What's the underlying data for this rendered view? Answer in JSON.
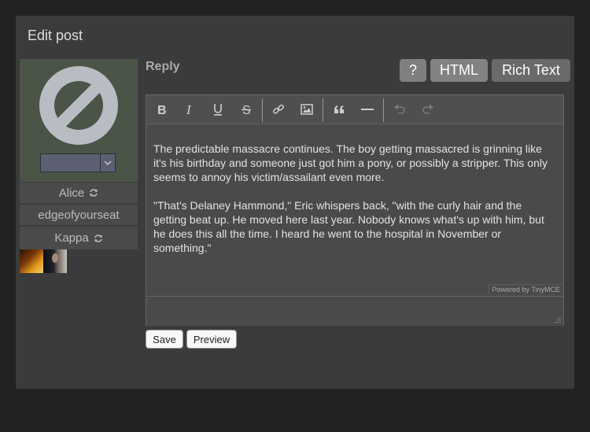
{
  "panel": {
    "title": "Edit post"
  },
  "sidebar": {
    "avatar_icon": "no-avatar-icon",
    "icon_select_value": "",
    "accounts": [
      {
        "name": "Alice",
        "has_refresh": true
      },
      {
        "name": "edgeofyourseat",
        "has_refresh": false
      },
      {
        "name": "Kappa",
        "has_refresh": true
      }
    ],
    "thumbnails": [
      "landscape-thumbnail",
      "person-thumbnail"
    ]
  },
  "main": {
    "reply_label": "Reply",
    "mode_buttons": {
      "help": "?",
      "html": "HTML",
      "rich_text": "Rich Text"
    }
  },
  "editor": {
    "toolbar": [
      "bold-icon",
      "italic-icon",
      "underline-icon",
      "strikethrough-icon",
      "link-icon",
      "image-icon",
      "blockquote-icon",
      "horizontal-rule-icon",
      "undo-icon",
      "redo-icon"
    ],
    "paragraphs": [
      "The predictable massacre continues. The boy getting massacred is grinning like it's his birthday and someone just got him a pony, or possibly a stripper. This only seems to annoy his victim/assailant even more.",
      "\"That's Delaney Hammond,\" Eric whispers back, \"with the curly hair and the getting beat up. He moved here last year. Nobody knows what's up with him, but he does this all the time. I heard he went to the hospital in November or something.\""
    ],
    "powered_by": "Powered by TinyMCE"
  },
  "form": {
    "save_label": "Save",
    "preview_label": "Preview"
  },
  "colors": {
    "page_bg": "#222222",
    "panel_bg": "#3b3b3b",
    "avatar_bg": "#4a5447"
  }
}
